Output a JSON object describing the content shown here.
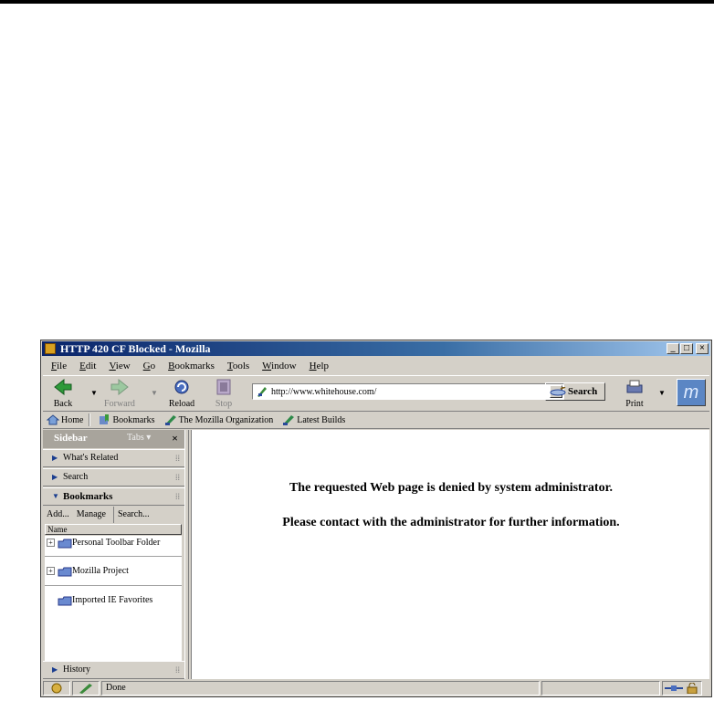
{
  "window": {
    "title": "HTTP 420 CF Blocked - Mozilla"
  },
  "menu": [
    {
      "label": "File",
      "u": "F",
      "rest": "ile"
    },
    {
      "label": "Edit",
      "u": "E",
      "rest": "dit"
    },
    {
      "label": "View",
      "u": "V",
      "rest": "iew"
    },
    {
      "label": "Go",
      "u": "G",
      "rest": "o"
    },
    {
      "label": "Bookmarks",
      "u": "B",
      "rest": "ookmarks"
    },
    {
      "label": "Tools",
      "u": "T",
      "rest": "ools"
    },
    {
      "label": "Window",
      "u": "W",
      "rest": "indow"
    },
    {
      "label": "Help",
      "u": "H",
      "rest": "elp"
    }
  ],
  "navbar": {
    "back": "Back",
    "forward": "Forward",
    "reload": "Reload",
    "stop": "Stop",
    "url": "http://www.whitehouse.com/",
    "search": "Search",
    "print": "Print"
  },
  "personal_toolbar": {
    "home": "Home",
    "bookmarks": "Bookmarks",
    "link1": "The Mozilla Organization",
    "link2": "Latest Builds"
  },
  "sidebar": {
    "title": "Sidebar",
    "tabs": "Tabs",
    "close": "×",
    "panels": {
      "whats_related": "What's Related",
      "search": "Search",
      "bookmarks": "Bookmarks",
      "history": "History"
    },
    "bm_toolbar": {
      "add": "Add...",
      "manage": "Manage",
      "search": "Search..."
    },
    "column": "Name",
    "items": [
      "Personal Toolbar Folder",
      "Mozilla Project",
      "Imported IE Favorites"
    ]
  },
  "content": {
    "line1": "The requested Web page is denied by system administrator.",
    "line2": "Please contact with the administrator for further information."
  },
  "status": {
    "text": "Done"
  },
  "colors": {
    "title_start": "#0a246a",
    "title_end": "#a6caf0",
    "chrome": "#d4d0c8"
  }
}
